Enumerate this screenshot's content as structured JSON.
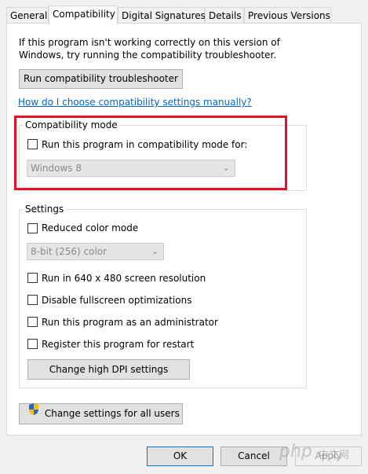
{
  "tabs": [
    {
      "label": "General"
    },
    {
      "label": "Compatibility"
    },
    {
      "label": "Digital Signatures"
    },
    {
      "label": "Details"
    },
    {
      "label": "Previous Versions"
    }
  ],
  "intro_line1": "If this program isn't working correctly on this version of",
  "intro_line2": "Windows, try running the compatibility troubleshooter.",
  "troubleshooter_button": "Run compatibility troubleshooter",
  "help_link": "How do I choose compatibility settings manually?",
  "compat_mode": {
    "legend": "Compatibility mode",
    "checkbox_label": "Run this program in compatibility mode for:",
    "checked": false,
    "os_value": "Windows 8"
  },
  "settings": {
    "legend": "Settings",
    "reduced_color": {
      "label": "Reduced color mode",
      "checked": false
    },
    "color_value": "8-bit (256) color",
    "res640": {
      "label": "Run in 640 x 480 screen resolution",
      "checked": false
    },
    "fullscreen": {
      "label": "Disable fullscreen optimizations",
      "checked": false
    },
    "admin": {
      "label": "Run this program as an administrator",
      "checked": false
    },
    "restart": {
      "label": "Register this program for restart",
      "checked": false
    },
    "dpi_button": "Change high DPI settings"
  },
  "all_users_button": "Change settings for all users",
  "footer": {
    "ok": "OK",
    "cancel": "Cancel",
    "apply": "Apply"
  },
  "watermark": {
    "logo": "php",
    "site": "中文网"
  },
  "colors": {
    "highlight": "#e81123",
    "link": "#0066cc",
    "default_border": "#0078d7"
  }
}
